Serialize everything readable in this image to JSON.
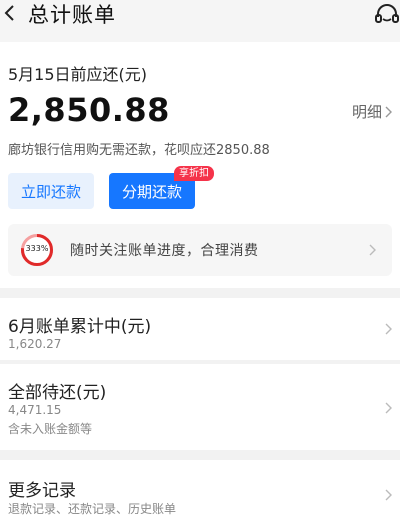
{
  "header": {
    "title": "总计账单",
    "back_icon": "chevron-left-icon",
    "service_icon": "customer-service-icon"
  },
  "bill": {
    "due_label": "5月15日前应还(元)",
    "amount": "2,850.88",
    "detail_label": "明细",
    "note": "廊坊银行信用购无需还款，花呗应还2850.88",
    "repay_button": "立即还款",
    "installment_button": "分期还款",
    "promo_badge": "享折扣",
    "accent_color": "#1677ff",
    "badge_color": "#f5334a"
  },
  "tip": {
    "gauge_value": "333%",
    "text": "随时关注账单进度，合理消费"
  },
  "june": {
    "title": "6月账单累计中(元)",
    "amount": "1,620.27"
  },
  "pending": {
    "title": "全部待还(元)",
    "amount": "4,471.15",
    "note": "含未入账金额等"
  },
  "more": {
    "title": "更多记录",
    "subtitle": "退款记录、还款记录、历史账单"
  }
}
